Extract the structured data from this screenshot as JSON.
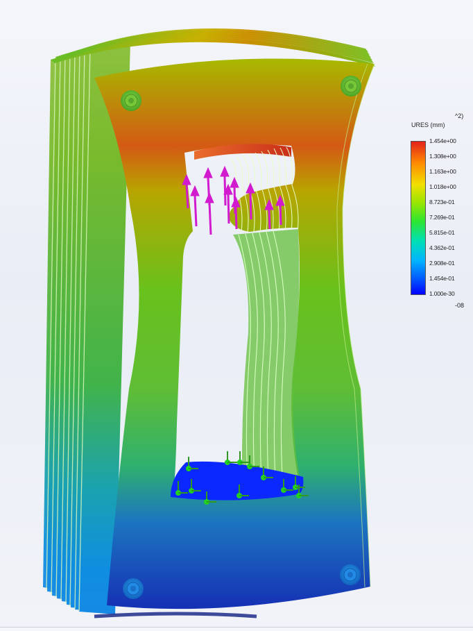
{
  "legend": {
    "title": "URES (mm)",
    "exponent_top": "^2)",
    "exponent_bottom": "-08",
    "values": [
      "1.454e+00",
      "1.308e+00",
      "1.163e+00",
      "1.018e+00",
      "8.723e-01",
      "7.269e-01",
      "5.815e-01",
      "4.362e-01",
      "2.908e-01",
      "1.454e-01",
      "1.000e-30"
    ],
    "colors": [
      "#e3231a",
      "#ff8a00",
      "#f2df00",
      "#99e500",
      "#2fe52f",
      "#00e0b5",
      "#00b4ff",
      "#0057ff",
      "#0000ff"
    ]
  },
  "model": {
    "gradient_colors": [
      "#c9a000",
      "#8ec300",
      "#4db630",
      "#1fa56f",
      "#1b71b8",
      "#1328b0"
    ],
    "hotspot_color": "#d34711",
    "load_arrow_color": "#d21bcf",
    "fixture_color": "#2f9a1f",
    "fixture_head_color": "#22d122"
  }
}
